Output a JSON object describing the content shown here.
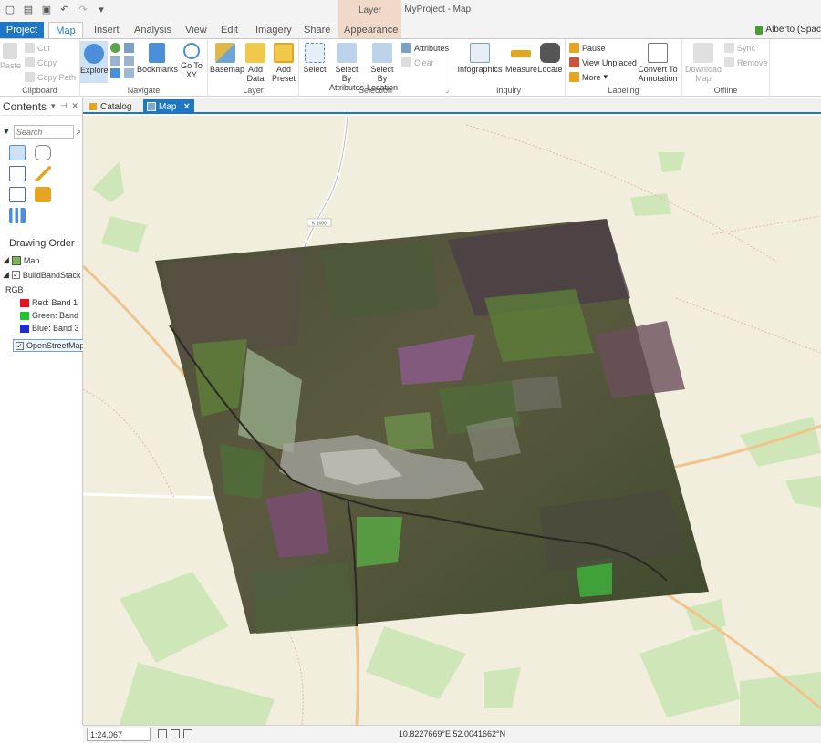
{
  "app": {
    "title": "ArcGIS Pro - MyProject - Map",
    "context_tab_group": "Layer",
    "user": "Alberto (Spac"
  },
  "tabs": [
    "Project",
    "Map",
    "Insert",
    "Analysis",
    "View",
    "Edit",
    "Imagery",
    "Share",
    "Appearance"
  ],
  "ribbon": {
    "clipboard": {
      "label": "Clipboard",
      "paste": "Paste",
      "cut": "Cut",
      "copy": "Copy",
      "copy_path": "Copy Path"
    },
    "navigate": {
      "label": "Navigate",
      "explore": "Explore",
      "bookmarks": "Bookmarks",
      "go_to_xy": "Go To XY"
    },
    "layer": {
      "label": "Layer",
      "basemap": "Basemap",
      "add_data": "Add Data",
      "add_preset": "Add Preset"
    },
    "selection": {
      "label": "Selection",
      "select": "Select",
      "select_by_attributes": "Select By Attributes",
      "select_by_location": "Select By Location",
      "attributes": "Attributes",
      "clear": "Clear"
    },
    "inquiry": {
      "label": "Inquiry",
      "infographics": "Infographics",
      "measure": "Measure",
      "locate": "Locate"
    },
    "labeling": {
      "label": "Labeling",
      "pause": "Pause",
      "view_unplaced": "View Unplaced",
      "more": "More",
      "convert_to_annotation": "Convert To Annotation"
    },
    "offline": {
      "label": "Offline",
      "download_map": "Download Map",
      "sync": "Sync",
      "remove": "Remove"
    }
  },
  "contents": {
    "title": "Contents",
    "search_placeholder": "Search",
    "drawing_order": "Drawing Order",
    "map_node": "Map",
    "layer_name": "BuildBandStack",
    "rgb_label": "RGB",
    "bands": [
      {
        "label": "Red:  Band 1",
        "color": "#e8121a"
      },
      {
        "label": "Green: Band",
        "color": "#21c52a"
      },
      {
        "label": "Blue:  Band 3",
        "color": "#1b2dd6"
      }
    ],
    "basemap_layer": "OpenStreetMap"
  },
  "view_tabs": {
    "catalog": "Catalog",
    "map": "Map"
  },
  "status": {
    "scale": "1:24,067",
    "coordinates": "10.8227669°E 52.0041662°N"
  },
  "map_labels": {
    "road_label_north": "K 1000"
  },
  "colors": {
    "accent": "#1e77c6",
    "map_background": "#f1eedd",
    "road": "#f0c48c",
    "green_area": "#cfe7b8"
  }
}
